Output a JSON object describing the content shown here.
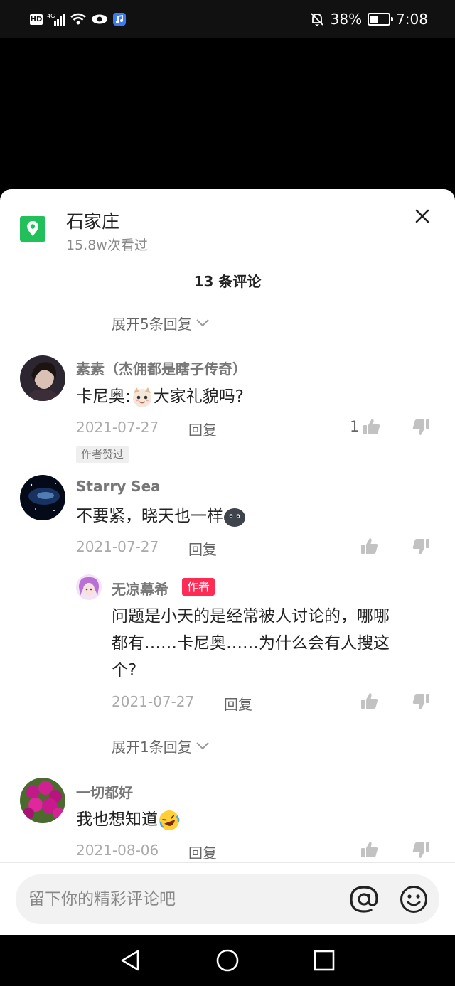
{
  "status_bar": {
    "network": "4G",
    "battery": "38%",
    "time": "7:08"
  },
  "header": {
    "location_name": "石家庄",
    "views": "15.8w次看过"
  },
  "comment_count": "13 条评论",
  "expand_top": "展开5条回复",
  "comments": [
    {
      "user": "素素（杰佣都是瞎子传奇）",
      "text_before": "卡尼奥:",
      "text_after": "大家礼貌吗?",
      "emoji": "cat-emoji",
      "date": "2021-07-27",
      "reply": "回复",
      "likes": "1",
      "badge": "作者赞过"
    },
    {
      "user": "Starry Sea",
      "text": "不要紧，晓天也一样",
      "emoji": "dark-face-emoji",
      "date": "2021-07-27",
      "reply": "回复"
    },
    {
      "user": "一切都好",
      "text": "我也想知道",
      "emoji": "laughing-emoji",
      "date": "2021-08-06",
      "reply": "回复"
    }
  ],
  "reply": {
    "user": "无凉幕希",
    "tag": "作者",
    "text_line1": "问题是小天的是经常被人讨论的，哪哪",
    "text_line2": "都有……卡尼奥……为什么会有人搜这",
    "text_line3": "个?",
    "date": "2021-07-27",
    "reply": "回复"
  },
  "expand_mid": "展开1条回复",
  "input": {
    "placeholder": "留下你的精彩评论吧"
  },
  "colors": {
    "accent": "#fe2c55",
    "location_green": "#21c05a"
  },
  "icons": [
    "location-pin-icon",
    "close-icon",
    "thumb-up-icon",
    "thumb-down-icon",
    "at-icon",
    "emoji-icon",
    "back-icon",
    "home-icon",
    "recents-icon"
  ]
}
